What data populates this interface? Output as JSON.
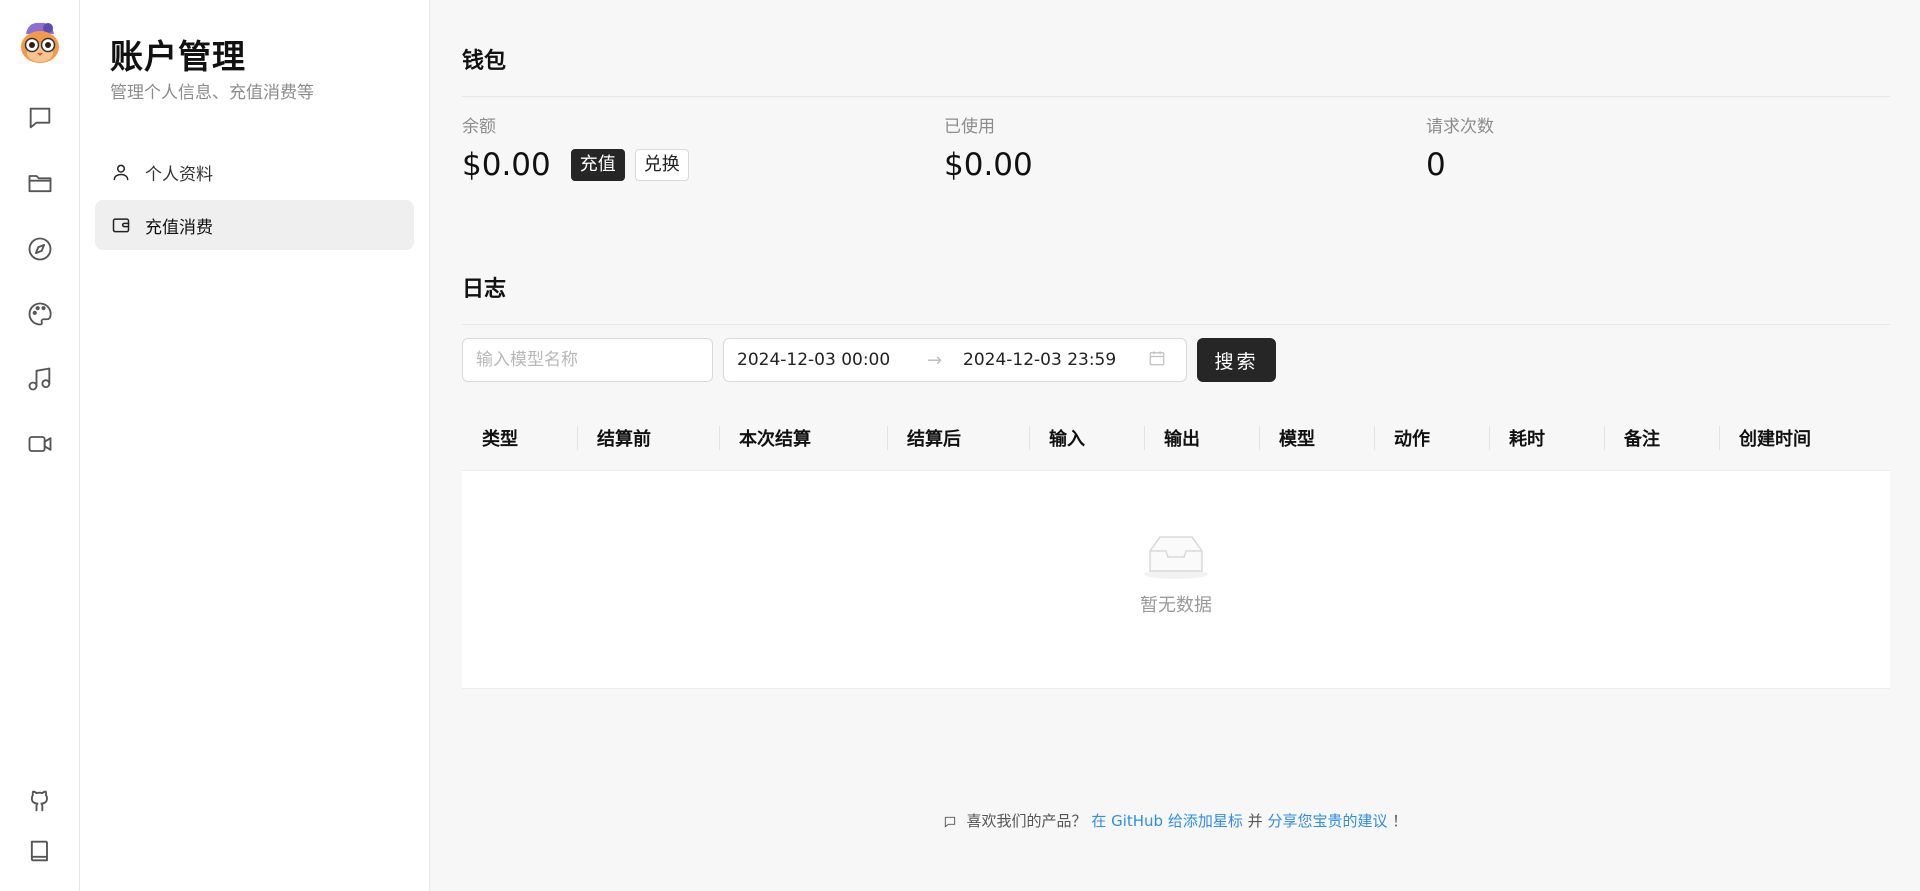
{
  "sidebar": {
    "title": "账户管理",
    "subtitle": "管理个人信息、充值消费等",
    "items": [
      {
        "label": "个人资料",
        "icon": "user-icon"
      },
      {
        "label": "充值消费",
        "icon": "wallet-icon",
        "active": true
      }
    ]
  },
  "rail": {
    "icons": [
      "chat-icon",
      "folder-icon",
      "compass-icon",
      "palette-icon",
      "music-icon",
      "video-icon",
      "github-icon",
      "book-icon"
    ]
  },
  "wallet": {
    "title": "钱包",
    "balance_label": "余额",
    "balance_value": "$0.00",
    "recharge_label": "充值",
    "redeem_label": "兑换",
    "used_label": "已使用",
    "used_value": "$0.00",
    "requests_label": "请求次数",
    "requests_value": "0"
  },
  "log": {
    "title": "日志",
    "model_placeholder": "输入模型名称",
    "date_start": "2024-12-03 00:00",
    "date_arrow": "→",
    "date_end": "2024-12-03 23:59",
    "search_label": "搜索",
    "columns": [
      "类型",
      "结算前",
      "本次结算",
      "结算后",
      "输入",
      "输出",
      "模型",
      "动作",
      "耗时",
      "备注",
      "创建时间"
    ],
    "empty_text": "暂无数据"
  },
  "footer": {
    "prefix": "喜欢我们的产品？",
    "link1": "在 GitHub 给添加星标",
    "middle": "并",
    "link2": "分享您宝贵的建议",
    "suffix": "！"
  },
  "colors": {
    "accent_dark": "#262626",
    "link": "#2f8de4"
  }
}
